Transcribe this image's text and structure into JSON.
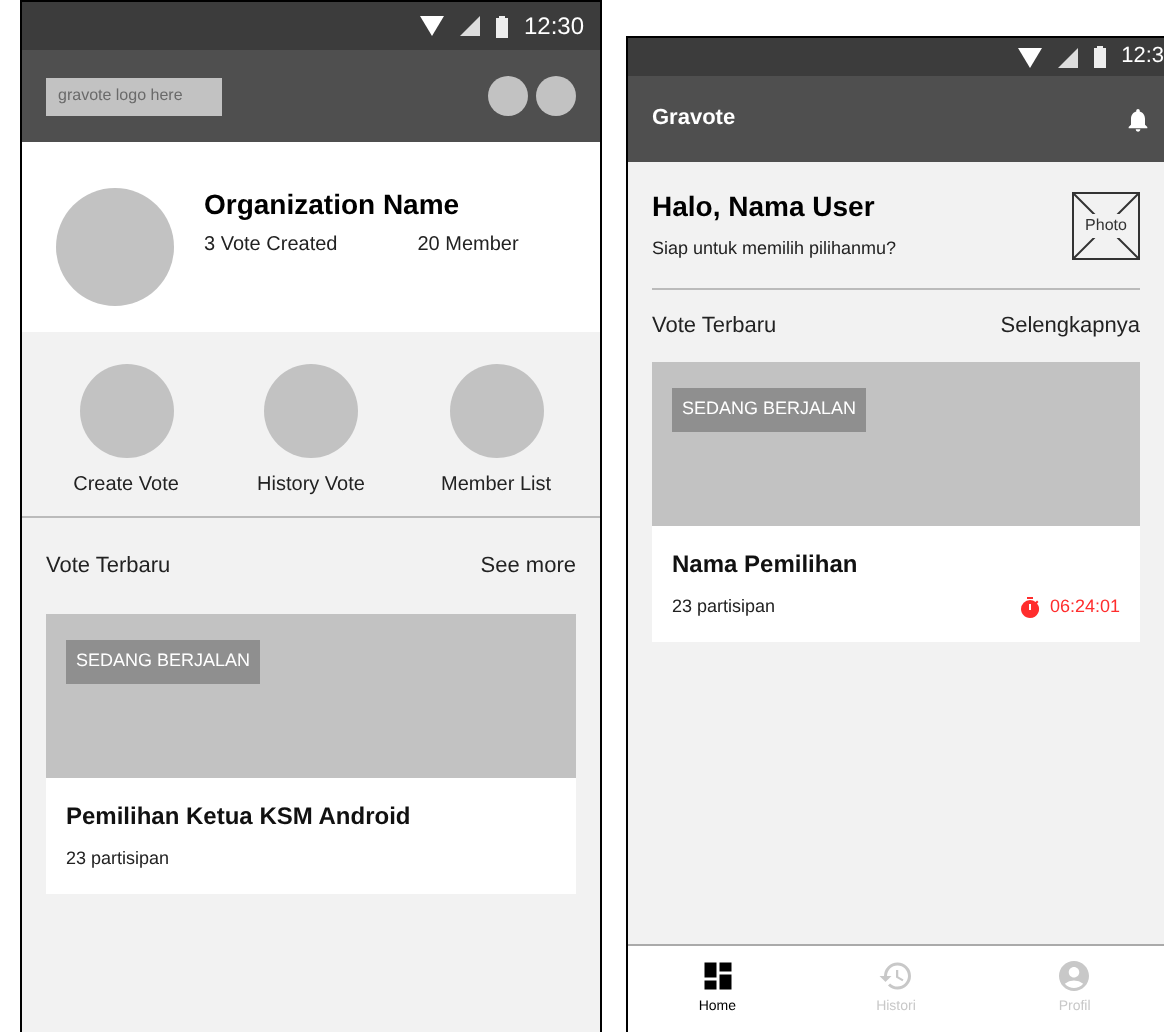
{
  "left_screen": {
    "status_bar": {
      "time": "12:30"
    },
    "app_bar": {
      "logo_placeholder": "gravote logo here"
    },
    "organization": {
      "name": "Organization Name",
      "votes": "3 Vote Created",
      "members": "20 Member"
    },
    "menu": [
      {
        "label": "Create Vote"
      },
      {
        "label": "History Vote"
      },
      {
        "label": "Member List"
      }
    ],
    "section": {
      "title": "Vote Terbaru",
      "link": "See more"
    },
    "vote_card": {
      "status": "SEDANG BERJALAN",
      "title": "Pemilihan Ketua KSM Android",
      "participants": "23 partisipan"
    }
  },
  "right_screen": {
    "status_bar": {
      "time": "12:3"
    },
    "app_bar": {
      "title": "Gravote"
    },
    "greeting": {
      "title": "Halo, Nama User",
      "subtitle": "Siap untuk memilih pilihanmu?",
      "photo_label": "Photo"
    },
    "section": {
      "title": "Vote Terbaru",
      "link": "Selengkapnya"
    },
    "vote_card": {
      "status": "SEDANG BERJALAN",
      "title": "Nama Pemilihan",
      "participants": "23 partisipan",
      "timer": "06:24:01"
    },
    "bottom_nav": [
      {
        "label": "Home",
        "selected": true,
        "kind": "home"
      },
      {
        "label": "Histori",
        "selected": false,
        "kind": "history"
      },
      {
        "label": "Profil",
        "selected": false,
        "kind": "profile"
      }
    ]
  }
}
